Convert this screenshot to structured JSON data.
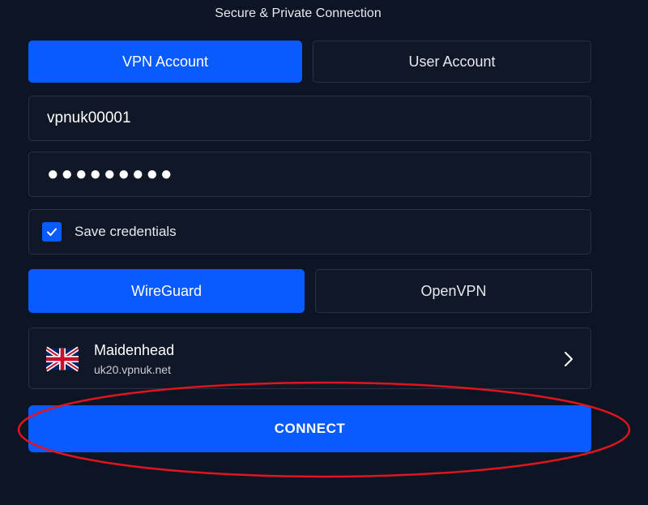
{
  "header": {
    "title": "Secure & Private Connection"
  },
  "account_tabs": {
    "vpn_account": "VPN Account",
    "user_account": "User Account",
    "selected": "vpn_account"
  },
  "login": {
    "username": "vpnuk00001",
    "password_mask": "●●●●●●●●●",
    "save_credentials_label": "Save credentials",
    "save_credentials_checked": true
  },
  "protocol_tabs": {
    "wireguard": "WireGuard",
    "openvpn": "OpenVPN",
    "selected": "wireguard"
  },
  "server": {
    "name": "Maidenhead",
    "host": "uk20.vpnuk.net",
    "flag_icon": "uk-flag-icon",
    "chevron_icon": "chevron-right-icon"
  },
  "connect_button": {
    "label": "CONNECT"
  },
  "colors": {
    "background": "#0d1424",
    "accent": "#0a5bff",
    "panel": "#101727",
    "border": "#2a3142",
    "annotation": "#e0141e"
  }
}
